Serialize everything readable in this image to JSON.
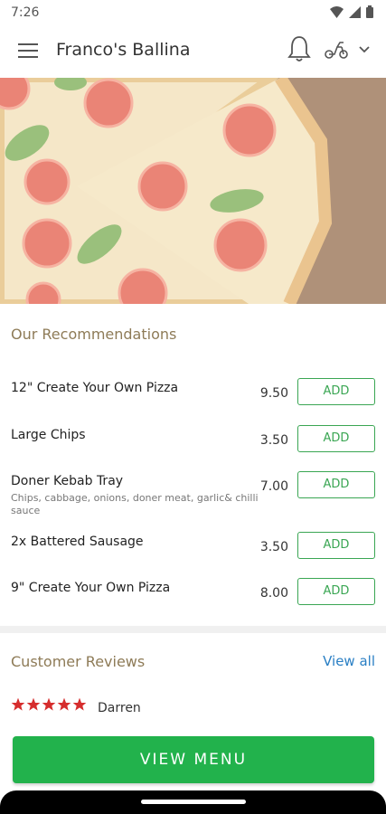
{
  "status": {
    "time": "7:26"
  },
  "header": {
    "title": "Franco's Ballina"
  },
  "icons": {
    "menu": "hamburger-menu-icon",
    "notifications": "bell-icon",
    "delivery": "scooter-icon",
    "dropdown": "chevron-down-icon"
  },
  "recommendations": {
    "title": "Our Recommendations",
    "items": [
      {
        "name": "12\" Create Your Own Pizza",
        "desc": "",
        "price": "9.50",
        "add": "ADD"
      },
      {
        "name": "Large Chips",
        "desc": "",
        "price": "3.50",
        "add": "ADD"
      },
      {
        "name": "Doner Kebab Tray",
        "desc": "Chips, cabbage, onions, doner meat, garlic& chilli sauce",
        "price": "7.00",
        "add": "ADD"
      },
      {
        "name": "2x Battered Sausage",
        "desc": "",
        "price": "3.50",
        "add": "ADD"
      },
      {
        "name": "9\" Create Your Own Pizza",
        "desc": "",
        "price": "8.00",
        "add": "ADD"
      }
    ]
  },
  "reviews": {
    "title": "Customer Reviews",
    "view_all": "View all",
    "items": [
      {
        "rating": 5,
        "name": "Darren"
      }
    ]
  },
  "cta": {
    "label": "VIEW MENU"
  },
  "colors": {
    "accent_green": "#22b24c",
    "link_blue": "#2a7fc4",
    "star_red": "#d62d2d",
    "section_tan": "#8e7b57"
  }
}
